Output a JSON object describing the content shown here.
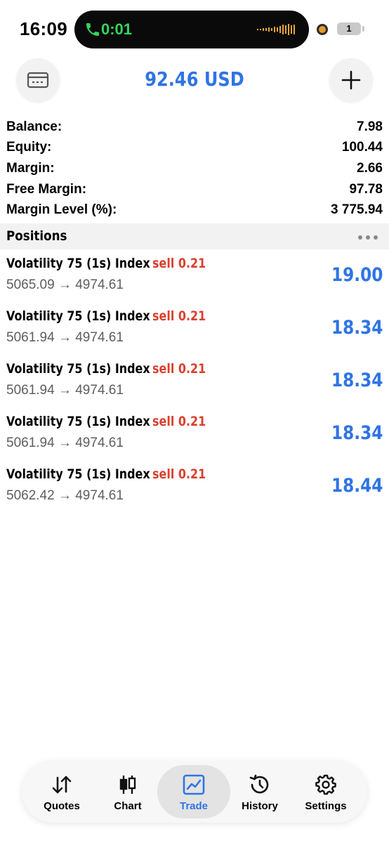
{
  "status_bar": {
    "time": "16:09",
    "call_timer": "0:01",
    "battery": "1"
  },
  "header": {
    "title": "92.46 USD",
    "left_icon": "card-icon",
    "right_icon": "plus-icon"
  },
  "summary": [
    {
      "label": "Balance:",
      "value": "7.98"
    },
    {
      "label": "Equity:",
      "value": "100.44"
    },
    {
      "label": "Margin:",
      "value": "2.66"
    },
    {
      "label": "Free Margin:",
      "value": "97.78"
    },
    {
      "label": "Margin Level (%):",
      "value": "3 775.94"
    }
  ],
  "positions_section": {
    "title": "Positions",
    "items": [
      {
        "symbol": "Volatility 75 (1s) Index",
        "side": "sell 0.21",
        "prices": "5065.09 → 4974.61",
        "profit": "19.00"
      },
      {
        "symbol": "Volatility 75 (1s) Index",
        "side": "sell 0.21",
        "prices": "5061.94 → 4974.61",
        "profit": "18.34"
      },
      {
        "symbol": "Volatility 75 (1s) Index",
        "side": "sell 0.21",
        "prices": "5061.94 → 4974.61",
        "profit": "18.34"
      },
      {
        "symbol": "Volatility 75 (1s) Index",
        "side": "sell 0.21",
        "prices": "5061.94 → 4974.61",
        "profit": "18.34"
      },
      {
        "symbol": "Volatility 75 (1s) Index",
        "side": "sell 0.21",
        "prices": "5062.42 → 4974.61",
        "profit": "18.44"
      }
    ]
  },
  "tabbar": {
    "tabs": [
      {
        "label": "Quotes",
        "icon": "quotes-arrows-icon"
      },
      {
        "label": "Chart",
        "icon": "candlestick-icon"
      },
      {
        "label": "Trade",
        "icon": "trade-chart-icon",
        "active": true
      },
      {
        "label": "History",
        "icon": "history-clock-icon"
      },
      {
        "label": "Settings",
        "icon": "gear-icon"
      }
    ]
  },
  "colors": {
    "accent": "#2f74e4",
    "sell": "#d9402f",
    "call_green": "#35d45c"
  }
}
